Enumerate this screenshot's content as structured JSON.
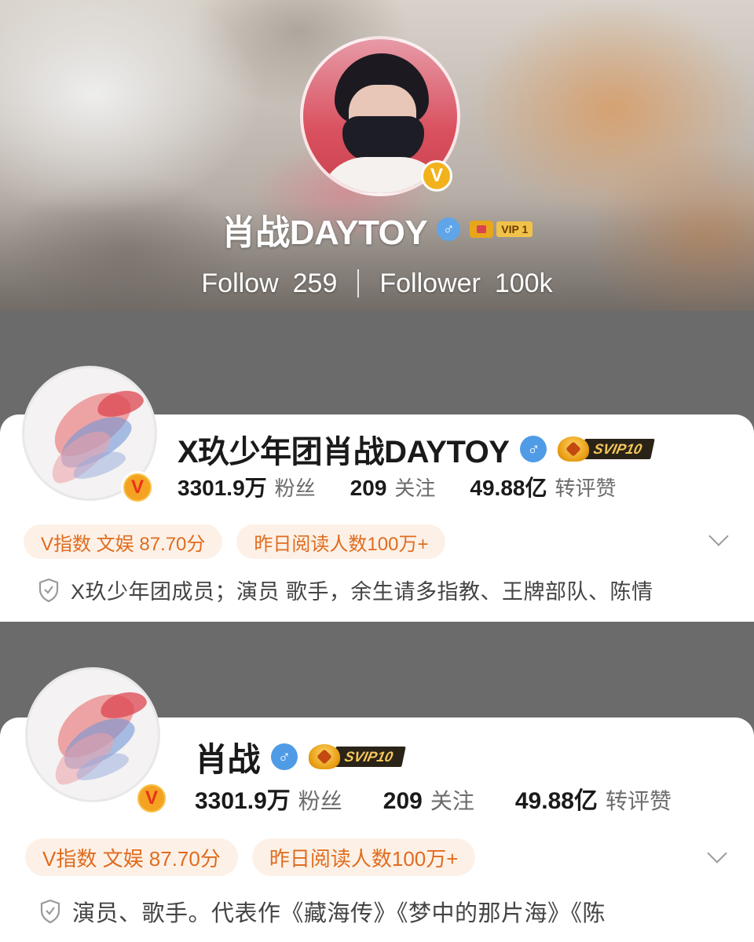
{
  "panel_top": {
    "name": "肖战DAYTOY",
    "vip_label": "VIP 1",
    "follow_label": "Follow",
    "follow_count": "259",
    "follower_label": "Follower",
    "follower_count": "100k",
    "verified_badge": "V"
  },
  "profile_a": {
    "name": "X玖少年团肖战DAYTOY",
    "svip_label": "SVIP10",
    "verified_badge": "V",
    "stats": [
      {
        "value": "3301.9万",
        "label": "粉丝"
      },
      {
        "value": "209",
        "label": "关注"
      },
      {
        "value": "49.88亿",
        "label": "转评赞"
      }
    ],
    "tags": [
      "V指数 文娱 87.70分",
      "昨日阅读人数100万+"
    ],
    "bio": "X玖少年团成员；演员 歌手，余生请多指教、王牌部队、陈情"
  },
  "profile_b": {
    "name": "肖战",
    "svip_label": "SVIP10",
    "verified_badge": "V",
    "stats": [
      {
        "value": "3301.9万",
        "label": "粉丝"
      },
      {
        "value": "209",
        "label": "关注"
      },
      {
        "value": "49.88亿",
        "label": "转评赞"
      }
    ],
    "tags": [
      "V指数 文娱 87.70分",
      "昨日阅读人数100万+"
    ],
    "bio": "演员、歌手。代表作《藏海传》《梦中的那片海》《陈"
  },
  "icons": {
    "gender": "male-icon",
    "expand": "chevron-down-icon",
    "bio": "shield-icon",
    "vip": "crown-icon"
  },
  "colors": {
    "tag_text": "#e06c1f",
    "tag_bg": "#fdf1e7",
    "male_badge": "#4f9be6",
    "verified_badge": "#f3a221",
    "divider_gray": "#6b6b6b"
  }
}
